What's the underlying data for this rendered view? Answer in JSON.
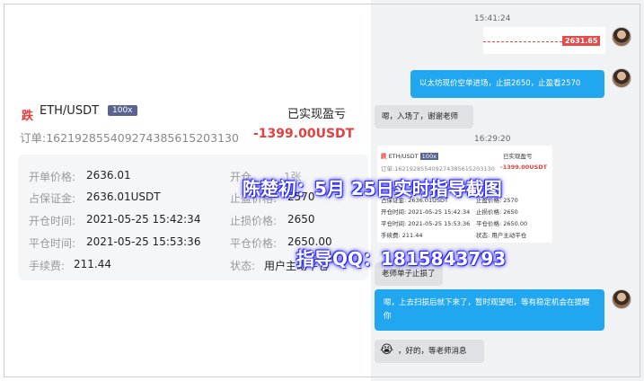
{
  "chat": {
    "timestamp1": "15:41:24",
    "chart_price": "2631.65",
    "msg_user_1": "以太坊现价空单进场，止损2650，止盈看2570",
    "msg_reply_1": "嗯，入场了，谢谢老师",
    "timestamp2": "16:29:20",
    "msg_reply_2": "老师单子止损了",
    "msg_user_2": "嗯，上去扫损后就下来了，暂时观望吧，等有稳定机会在提醒你",
    "msg_reply_3": "，好的，等老师消息"
  },
  "order": {
    "side_badge": "跌",
    "pair": "ETH/USDT",
    "leverage": "100x",
    "realized_label": "已实现盈亏",
    "order_no": "订单:1621928554092743856152031​30",
    "pnl": "-1399.00USDT",
    "open_price_label": "开单价格:",
    "open_price": "2636.01",
    "margin_label": "占保证金:",
    "margin": "2636.01USDT",
    "open_time_label": "开仓时间:",
    "open_time": "2021-05-25 15:42:34",
    "close_time_label": "平仓时间:",
    "close_time": "2021-05-25 15:53:36",
    "fee_label": "手续费:",
    "fee": "211.44",
    "right_label_1": "开仓",
    "right_value_1": "1张",
    "take_profit_label": "止盈价格:",
    "take_profit": "2570",
    "stop_loss_label": "止损价格:",
    "stop_loss": "2650",
    "close_price_label": "平仓价格:",
    "close_price": "2650.00",
    "status_label": "状态:",
    "status": "用户主动平仓"
  },
  "mini": {
    "pair": "ETH/USDT",
    "leverage": "100x",
    "realized_label": "已实现盈亏",
    "order_no": "订单:1621928554092743856152031​30",
    "pnl": "-1399.00USDT",
    "open_price": "开单价格: 2636.01",
    "margin": "占保证金: 2636.01USDT",
    "open_time": "开仓时间: 2021-05-25 15:42:34",
    "close_time": "平仓时间: 2021-05-25 15:53:36",
    "fee": "手续费: 211.44",
    "take_profit": "止盈价格: 2570",
    "stop_loss": "止损价格: 2650",
    "close_price": "平仓价格: 2650.00",
    "status": "状态: 用户主动平仓"
  },
  "watermark": {
    "line1": "陈楚初：5月 25日实时指导截图",
    "line2": "指导QQ：1815843793"
  }
}
